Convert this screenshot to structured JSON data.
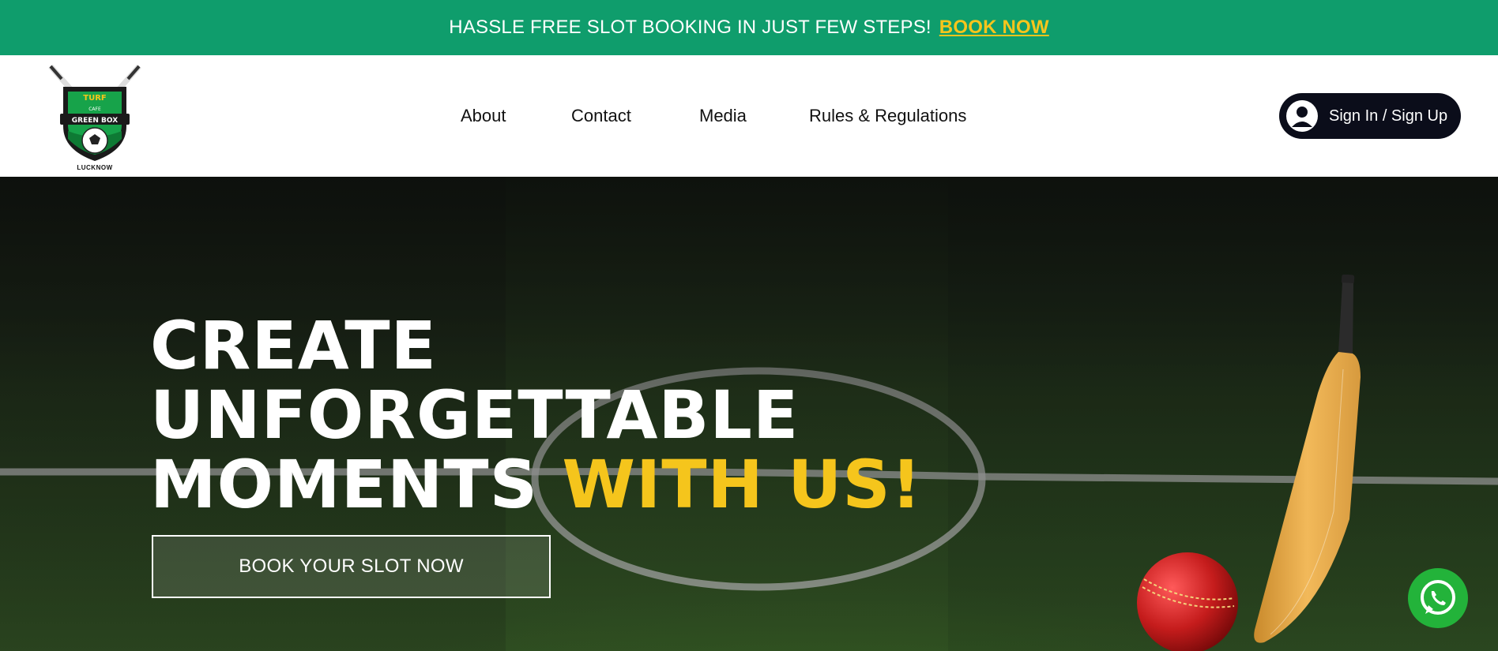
{
  "promo": {
    "text": "HASSLE FREE SLOT BOOKING IN JUST FEW STEPS!",
    "link_label": "BOOK NOW",
    "link_color": "#f7c51c",
    "background": "#0f9d6c"
  },
  "header": {
    "logo": {
      "line1": "TURF",
      "line2": "CAFE",
      "banner": "GREEN BOX",
      "town": "LUCKNOW"
    },
    "nav": [
      {
        "label": "About"
      },
      {
        "label": "Contact"
      },
      {
        "label": "Media"
      },
      {
        "label": "Rules & Regulations"
      }
    ],
    "signin_label": "Sign In / Sign Up",
    "avatar_icon": "user-circle-icon"
  },
  "hero": {
    "headline_line1": "CREATE",
    "headline_line2": "UNFORGETTABLE",
    "headline_line3": "MOMENTS",
    "headline_accent": "WITH US!",
    "accent_color": "#f5c51c",
    "cta_label": "BOOK YOUR SLOT NOW",
    "decor_icons": [
      "cricket-ball-icon",
      "cricket-bat-icon"
    ],
    "chat_icon": "whatsapp-icon"
  }
}
